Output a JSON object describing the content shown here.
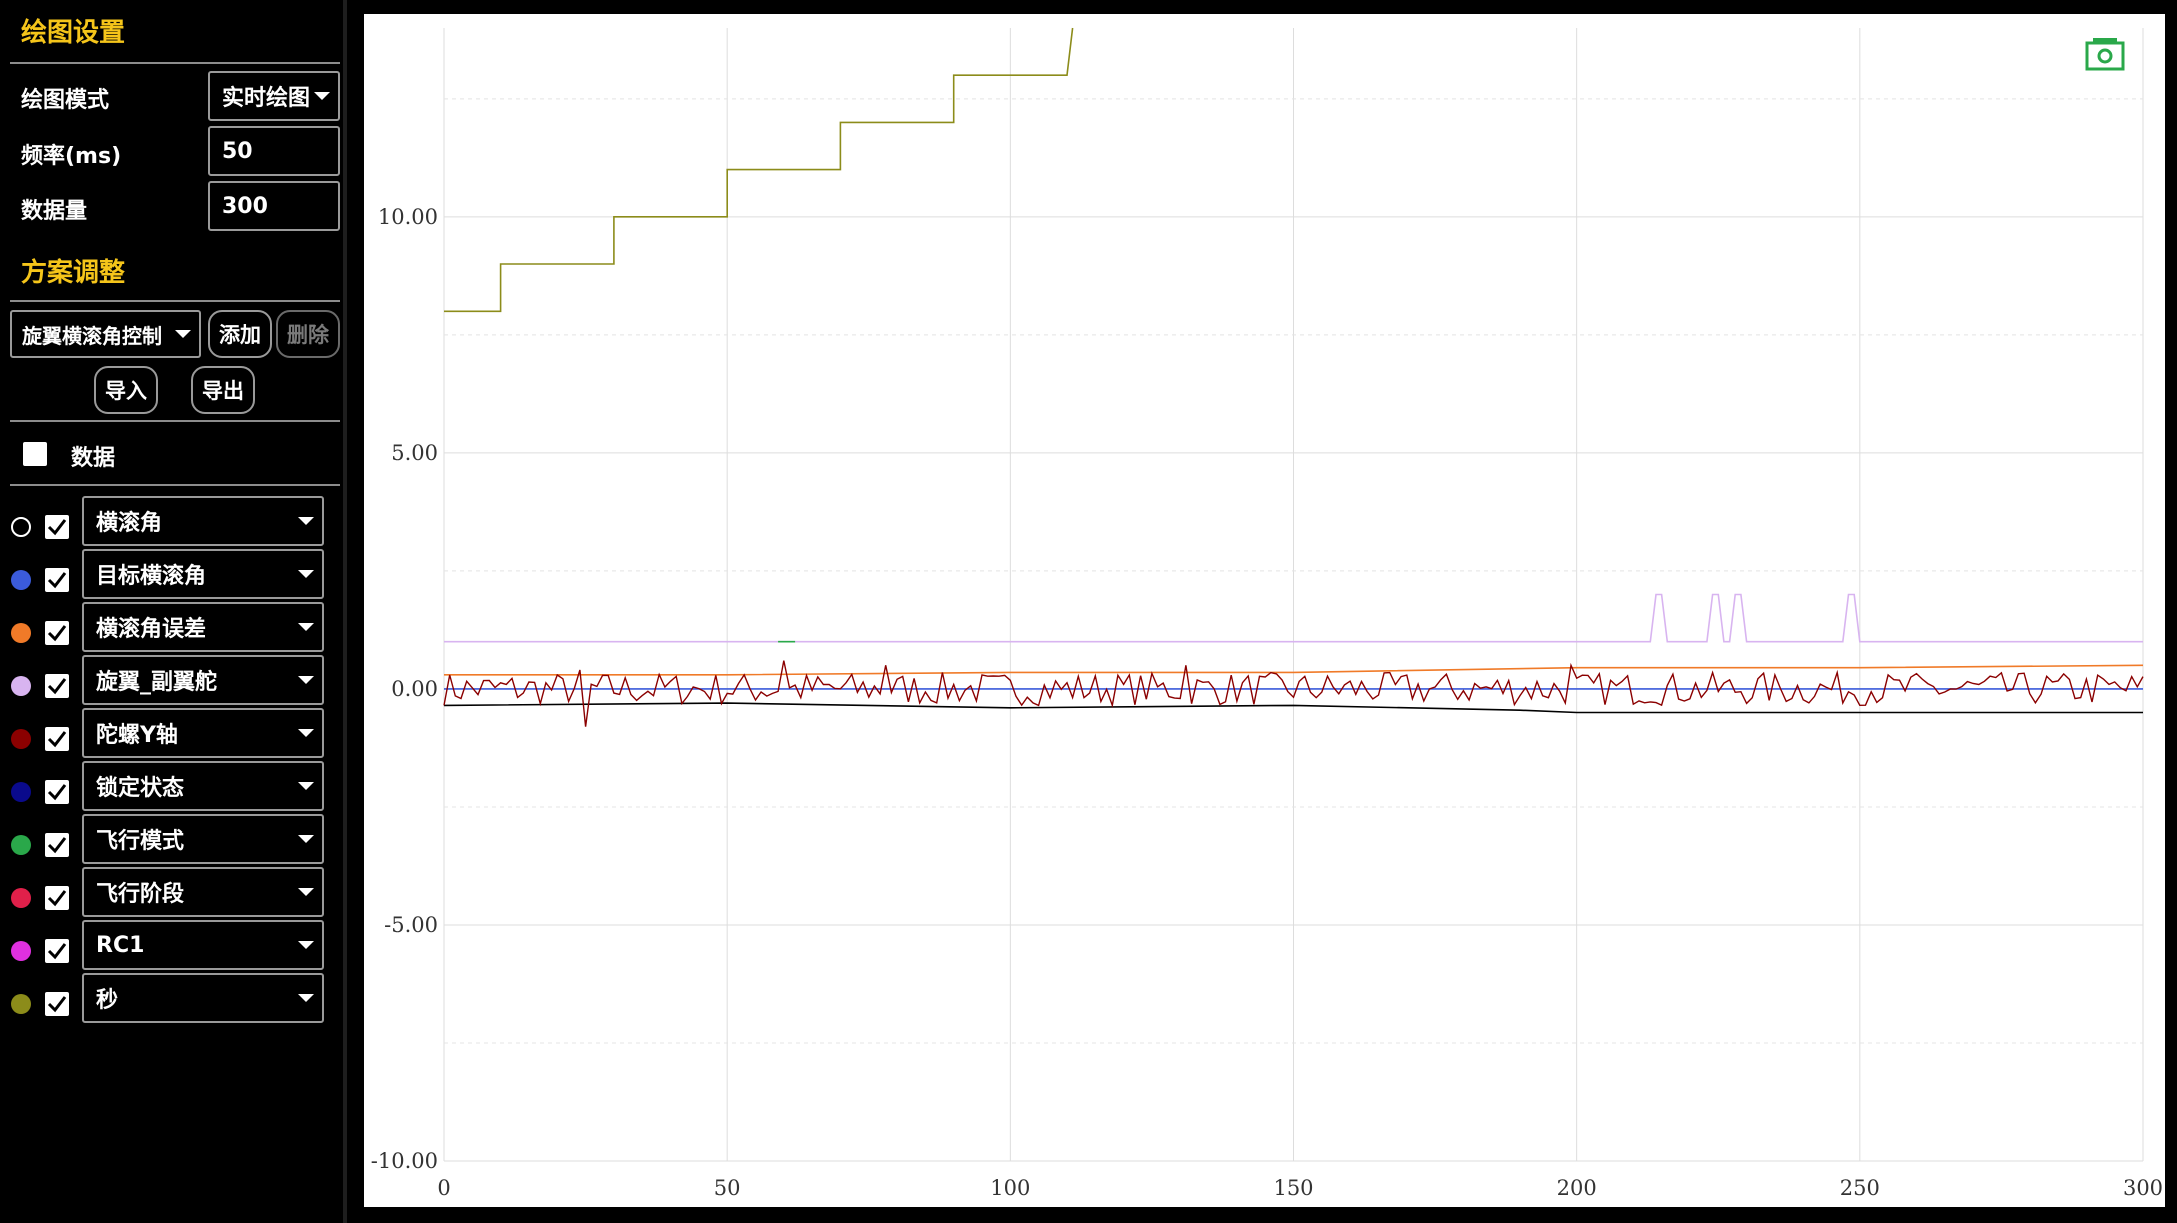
{
  "settings": {
    "title": "绘图设置",
    "mode_label": "绘图模式",
    "mode_value": "实时绘图",
    "freq_label": "频率(ms)",
    "freq_value": "50",
    "count_label": "数据量",
    "count_value": "300"
  },
  "scheme": {
    "title": "方案调整",
    "selected": "旋翼横滚角控制",
    "add_label": "添加",
    "delete_label": "删除",
    "import_label": "导入",
    "export_label": "导出"
  },
  "data_toggle": {
    "label": "数据",
    "checked": false
  },
  "series": [
    {
      "name": "横滚角",
      "color": "#000000",
      "checked": true
    },
    {
      "name": "目标横滚角",
      "color": "#3b5bdb",
      "checked": true
    },
    {
      "name": "横滚角误差",
      "color": "#f07a28",
      "checked": true
    },
    {
      "name": "旋翼_副翼舵",
      "color": "#d8b4f0",
      "checked": true
    },
    {
      "name": "陀螺Y轴",
      "color": "#8b0000",
      "checked": true
    },
    {
      "name": "锁定状态",
      "color": "#0a0a8c",
      "checked": true
    },
    {
      "name": "飞行模式",
      "color": "#2aa84a",
      "checked": true
    },
    {
      "name": "飞行阶段",
      "color": "#e0204a",
      "checked": true
    },
    {
      "name": "RC1",
      "color": "#e030e0",
      "checked": true
    },
    {
      "name": "秒",
      "color": "#8c8c1a",
      "checked": true
    }
  ],
  "chart_data": {
    "type": "line",
    "xlim": [
      0,
      300
    ],
    "ylim": [
      -10,
      14
    ],
    "x_ticks": [
      "0",
      "50",
      "100",
      "150",
      "200",
      "250",
      "300"
    ],
    "y_ticks": [
      "10.00",
      "5.00",
      "0.00",
      "-5.00",
      "-10.00"
    ],
    "grid": true,
    "series": [
      {
        "name": "秒",
        "color": "#8c8c1a",
        "points": [
          [
            0,
            8
          ],
          [
            10,
            8
          ],
          [
            10,
            9
          ],
          [
            30,
            9
          ],
          [
            30,
            10
          ],
          [
            50,
            10
          ],
          [
            50,
            11
          ],
          [
            70,
            11
          ],
          [
            70,
            12
          ],
          [
            90,
            12
          ],
          [
            90,
            13
          ],
          [
            110,
            13
          ],
          [
            111,
            14
          ]
        ]
      },
      {
        "name": "横滚角",
        "color": "#000000",
        "points": [
          [
            0,
            -0.35
          ],
          [
            50,
            -0.3
          ],
          [
            100,
            -0.4
          ],
          [
            150,
            -0.35
          ],
          [
            190,
            -0.45
          ],
          [
            200,
            -0.5
          ],
          [
            250,
            -0.5
          ],
          [
            300,
            -0.5
          ]
        ]
      },
      {
        "name": "横滚角误差",
        "color": "#f07a28",
        "points": [
          [
            0,
            0.3
          ],
          [
            50,
            0.3
          ],
          [
            100,
            0.35
          ],
          [
            150,
            0.35
          ],
          [
            200,
            0.45
          ],
          [
            250,
            0.45
          ],
          [
            300,
            0.5
          ]
        ]
      },
      {
        "name": "目标横滚角",
        "color": "#3b5bdb",
        "points": [
          [
            0,
            0
          ],
          [
            300,
            0
          ]
        ]
      },
      {
        "name": "旋翼_副翼舵",
        "color": "#d8b4f0",
        "points": [
          [
            0,
            1
          ],
          [
            213,
            1
          ],
          [
            214,
            2
          ],
          [
            215,
            2
          ],
          [
            216,
            1
          ],
          [
            223,
            1
          ],
          [
            224,
            2
          ],
          [
            225,
            2
          ],
          [
            226,
            1
          ],
          [
            227,
            1
          ],
          [
            228,
            2
          ],
          [
            229,
            2
          ],
          [
            230,
            1
          ],
          [
            247,
            1
          ],
          [
            248,
            2
          ],
          [
            249,
            2
          ],
          [
            250,
            1
          ],
          [
            300,
            1
          ]
        ]
      },
      {
        "name": "飞行模式",
        "color": "#2aa84a",
        "points": [
          [
            59,
            1
          ],
          [
            62,
            1
          ]
        ]
      }
    ],
    "noise_series": {
      "name": "陀螺Y轴",
      "color": "#8b0000",
      "amplitude": 0.35
    }
  }
}
